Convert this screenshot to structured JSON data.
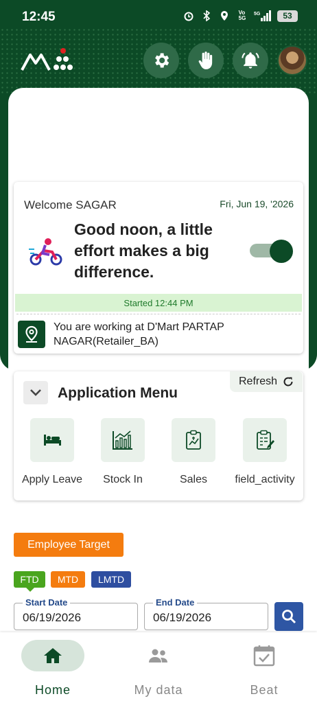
{
  "status_bar": {
    "time": "12:45",
    "network": "5G",
    "battery": "53"
  },
  "header": {
    "settings_icon": "gear-icon",
    "hand_icon": "hand-icon",
    "notification_icon": "bell-icon"
  },
  "welcome": {
    "title": "Welcome SAGAR",
    "date": "Fri, Jun 19, '2026",
    "greeting": "Good noon, a little effort makes a big difference.",
    "toggle_on": true,
    "started": "Started 12:44 PM",
    "location": "You are working at D'Mart PARTAP NAGAR(Retailer_BA)"
  },
  "app_menu": {
    "title": "Application Menu",
    "refresh_label": "Refresh",
    "items": [
      {
        "label": "Apply Leave",
        "icon": "bed-icon"
      },
      {
        "label": "Stock In",
        "icon": "stock-chart-icon"
      },
      {
        "label": "Sales",
        "icon": "sales-report-icon"
      },
      {
        "label": "field_activity",
        "icon": "clipboard-icon"
      }
    ]
  },
  "target": {
    "button_label": "Employee Target",
    "chips": [
      {
        "label": "FTD",
        "color": "#4aa51e"
      },
      {
        "label": "MTD",
        "color": "#f47c0f"
      },
      {
        "label": "LMTD",
        "color": "#2e4ea0"
      }
    ],
    "start_date": {
      "label": "Start Date",
      "value": "06/19/2026"
    },
    "end_date": {
      "label": "End Date",
      "value": "06/19/2026"
    }
  },
  "bottom_nav": {
    "items": [
      {
        "label": "Home",
        "icon": "home-icon",
        "active": true
      },
      {
        "label": "My data",
        "icon": "people-icon",
        "active": false
      },
      {
        "label": "Beat",
        "icon": "calendar-check-icon",
        "active": false
      }
    ]
  },
  "colors": {
    "primary": "#0c4a26",
    "accent_orange": "#f47c0f",
    "accent_blue": "#2e56a4",
    "started_bg": "#d9f3d2"
  }
}
